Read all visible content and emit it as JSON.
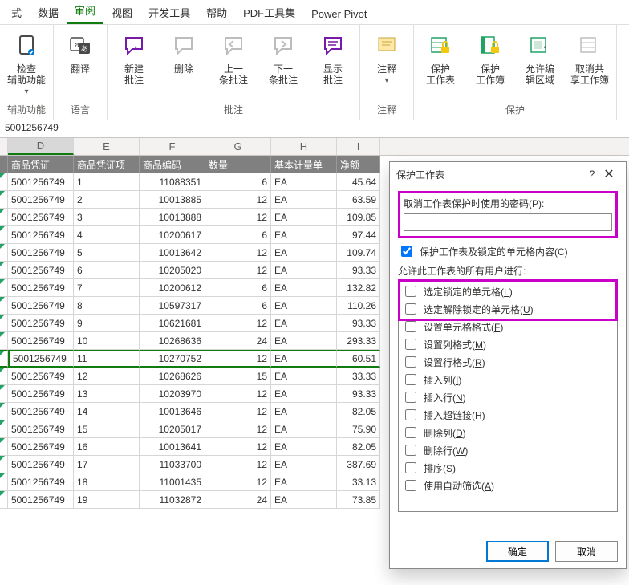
{
  "tabs": [
    "式",
    "数据",
    "审阅",
    "视图",
    "开发工具",
    "帮助",
    "PDF工具集",
    "Power Pivot"
  ],
  "active_tab_index": 2,
  "ribbon": {
    "groups": [
      {
        "label": "辅助功能",
        "buttons": [
          {
            "name": "accessibility",
            "label": "检查\n辅助功能",
            "caret": true
          }
        ]
      },
      {
        "label": "语言",
        "buttons": [
          {
            "name": "translate",
            "label": "翻译"
          }
        ]
      },
      {
        "label": "批注",
        "buttons": [
          {
            "name": "new-comment",
            "label": "新建\n批注"
          },
          {
            "name": "delete-comment",
            "label": "删除"
          },
          {
            "name": "prev-comment",
            "label": "上一\n条批注"
          },
          {
            "name": "next-comment",
            "label": "下一\n条批注"
          },
          {
            "name": "show-comments",
            "label": "显示\n批注"
          }
        ]
      },
      {
        "label": "注释",
        "buttons": [
          {
            "name": "notes",
            "label": "注释",
            "caret": true
          }
        ]
      },
      {
        "label": "保护",
        "buttons": [
          {
            "name": "protect-sheet",
            "label": "保护\n工作表"
          },
          {
            "name": "protect-workbook",
            "label": "保护\n工作簿"
          },
          {
            "name": "allow-edit-ranges",
            "label": "允许编\n辑区域"
          },
          {
            "name": "unshare",
            "label": "取消共\n享工作簿"
          }
        ]
      }
    ]
  },
  "formula_bar_value": "5001256749",
  "columns": [
    "",
    "D",
    "E",
    "F",
    "G",
    "H",
    "I"
  ],
  "selected_col_index": 1,
  "header_row": [
    "",
    "商品凭证",
    "商品凭证项",
    "商品编码",
    "数量",
    "基本计量单",
    "净额"
  ],
  "rows": [
    {
      "sel": false,
      "c": [
        "",
        "5001256749",
        "1",
        "11088351",
        "6",
        "EA",
        "45.64"
      ]
    },
    {
      "sel": false,
      "c": [
        "",
        "5001256749",
        "2",
        "10013885",
        "12",
        "EA",
        "63.59"
      ]
    },
    {
      "sel": false,
      "c": [
        "",
        "5001256749",
        "3",
        "10013888",
        "12",
        "EA",
        "109.85"
      ]
    },
    {
      "sel": false,
      "c": [
        "",
        "5001256749",
        "4",
        "10200617",
        "6",
        "EA",
        "97.44"
      ]
    },
    {
      "sel": false,
      "c": [
        "",
        "5001256749",
        "5",
        "10013642",
        "12",
        "EA",
        "109.74"
      ]
    },
    {
      "sel": false,
      "c": [
        "",
        "5001256749",
        "6",
        "10205020",
        "12",
        "EA",
        "93.33"
      ]
    },
    {
      "sel": false,
      "c": [
        "",
        "5001256749",
        "7",
        "10200612",
        "6",
        "EA",
        "132.82"
      ]
    },
    {
      "sel": false,
      "c": [
        "",
        "5001256749",
        "8",
        "10597317",
        "6",
        "EA",
        "110.26"
      ]
    },
    {
      "sel": false,
      "c": [
        "",
        "5001256749",
        "9",
        "10621681",
        "12",
        "EA",
        "93.33"
      ]
    },
    {
      "sel": false,
      "c": [
        "",
        "5001256749",
        "10",
        "10268636",
        "24",
        "EA",
        "293.33"
      ]
    },
    {
      "sel": true,
      "c": [
        "",
        "5001256749",
        "11",
        "10270752",
        "12",
        "EA",
        "60.51"
      ]
    },
    {
      "sel": false,
      "c": [
        "",
        "5001256749",
        "12",
        "10268626",
        "15",
        "EA",
        "33.33"
      ]
    },
    {
      "sel": false,
      "c": [
        "",
        "5001256749",
        "13",
        "10203970",
        "12",
        "EA",
        "93.33"
      ]
    },
    {
      "sel": false,
      "c": [
        "",
        "5001256749",
        "14",
        "10013646",
        "12",
        "EA",
        "82.05"
      ]
    },
    {
      "sel": false,
      "c": [
        "",
        "5001256749",
        "15",
        "10205017",
        "12",
        "EA",
        "75.90"
      ]
    },
    {
      "sel": false,
      "c": [
        "",
        "5001256749",
        "16",
        "10013641",
        "12",
        "EA",
        "82.05"
      ]
    },
    {
      "sel": false,
      "c": [
        "",
        "5001256749",
        "17",
        "11033700",
        "12",
        "EA",
        "387.69"
      ]
    },
    {
      "sel": false,
      "c": [
        "",
        "5001256749",
        "18",
        "11001435",
        "12",
        "EA",
        "33.13"
      ]
    },
    {
      "sel": false,
      "c": [
        "",
        "5001256749",
        "19",
        "11032872",
        "24",
        "EA",
        "73.85"
      ]
    }
  ],
  "numeric_cols": [
    3,
    4,
    6
  ],
  "dialog": {
    "title": "保护工作表",
    "help": "?",
    "password_label": "取消工作表保护时使用的密码(P):",
    "password_value": "",
    "protect_checkbox": {
      "checked": true,
      "label": "保护工作表及锁定的单元格内容(C)"
    },
    "allow_label": "允许此工作表的所有用户进行:",
    "options": [
      {
        "checked": false,
        "label": "选定锁定的单元格(L)",
        "m": "L"
      },
      {
        "checked": false,
        "label": "选定解除锁定的单元格(U)",
        "m": "U"
      },
      {
        "checked": false,
        "label": "设置单元格格式(F)",
        "m": "F"
      },
      {
        "checked": false,
        "label": "设置列格式(M)",
        "m": "M"
      },
      {
        "checked": false,
        "label": "设置行格式(R)",
        "m": "R"
      },
      {
        "checked": false,
        "label": "插入列(I)",
        "m": "I"
      },
      {
        "checked": false,
        "label": "插入行(N)",
        "m": "N"
      },
      {
        "checked": false,
        "label": "插入超链接(H)",
        "m": "H"
      },
      {
        "checked": false,
        "label": "删除列(D)",
        "m": "D"
      },
      {
        "checked": false,
        "label": "删除行(W)",
        "m": "W"
      },
      {
        "checked": false,
        "label": "排序(S)",
        "m": "S"
      },
      {
        "checked": false,
        "label": "使用自动筛选(A)",
        "m": "A"
      }
    ],
    "ok": "确定",
    "cancel": "取消"
  }
}
